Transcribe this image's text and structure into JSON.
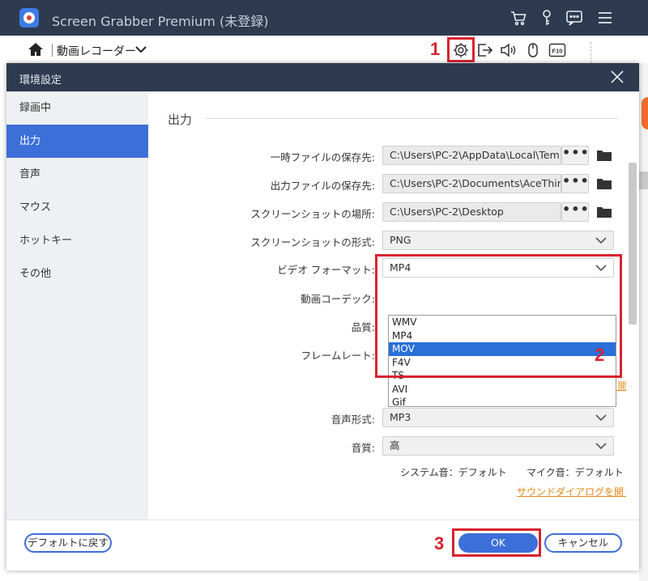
{
  "app": {
    "title": "Screen Grabber Premium (未登録)",
    "mode_label": "動画レコーダー",
    "colors": {
      "titlebar": "#2d3a4f",
      "accent": "#3d6fd9",
      "annotation": "#d9232e",
      "link": "#e88a1a"
    }
  },
  "titlebar_icons": [
    "cart-icon",
    "key-icon",
    "feedback-icon",
    "menu-icon"
  ],
  "toolbar_icons": [
    "gear-icon",
    "export-icon",
    "speaker-icon",
    "mouse-icon",
    "f10-hotkey-icon"
  ],
  "toolbar": {
    "f10_label": "F10"
  },
  "annotations": {
    "one": "1",
    "two": "2",
    "three": "3"
  },
  "dialog": {
    "title": "環境設定",
    "sidebar": [
      {
        "label": "録画中",
        "active": false
      },
      {
        "label": "出力",
        "active": true
      },
      {
        "label": "音声",
        "active": false
      },
      {
        "label": "マウス",
        "active": false
      },
      {
        "label": "ホットキー",
        "active": false
      },
      {
        "label": "その他",
        "active": false
      }
    ],
    "section_title": "出力",
    "rows": {
      "temp_path": {
        "label": "一時ファイルの保存先:",
        "value": "C:\\Users\\PC-2\\AppData\\Local\\Tem"
      },
      "output_path": {
        "label": "出力ファイルの保存先:",
        "value": "C:\\Users\\PC-2\\Documents\\AceThir"
      },
      "screenshot_path": {
        "label": "スクリーンショットの場所:",
        "value": "C:\\Users\\PC-2\\Desktop"
      },
      "screenshot_format": {
        "label": "スクリーンショットの形式:",
        "value": "PNG"
      },
      "video_format": {
        "label": "ビデオ フォーマット:",
        "value": "MP4"
      },
      "video_codec": {
        "label": "動画コーデック:"
      },
      "quality": {
        "label": "品質:"
      },
      "frame_rate": {
        "label": "フレームレート:"
      },
      "audio_format": {
        "label": "音声形式:",
        "value": "MP3"
      },
      "audio_quality": {
        "label": "音質:",
        "value": "高"
      }
    },
    "dots_label": "•••",
    "video_format_options": [
      "WMV",
      "MP4",
      "MOV",
      "F4V",
      "TS",
      "AVI",
      "Gif"
    ],
    "video_format_highlighted": "MOV",
    "display_dialog_link": "ディスプレイダイアログを開く",
    "system_sound": "システム音：デフォルト",
    "mic_sound": "マイク音：デフォルト",
    "sound_dialog_link": "サウンドダイアログを開く",
    "buttons": {
      "reset": "デフォルトに戻す",
      "ok": "OK",
      "cancel": "キャンセル"
    }
  }
}
